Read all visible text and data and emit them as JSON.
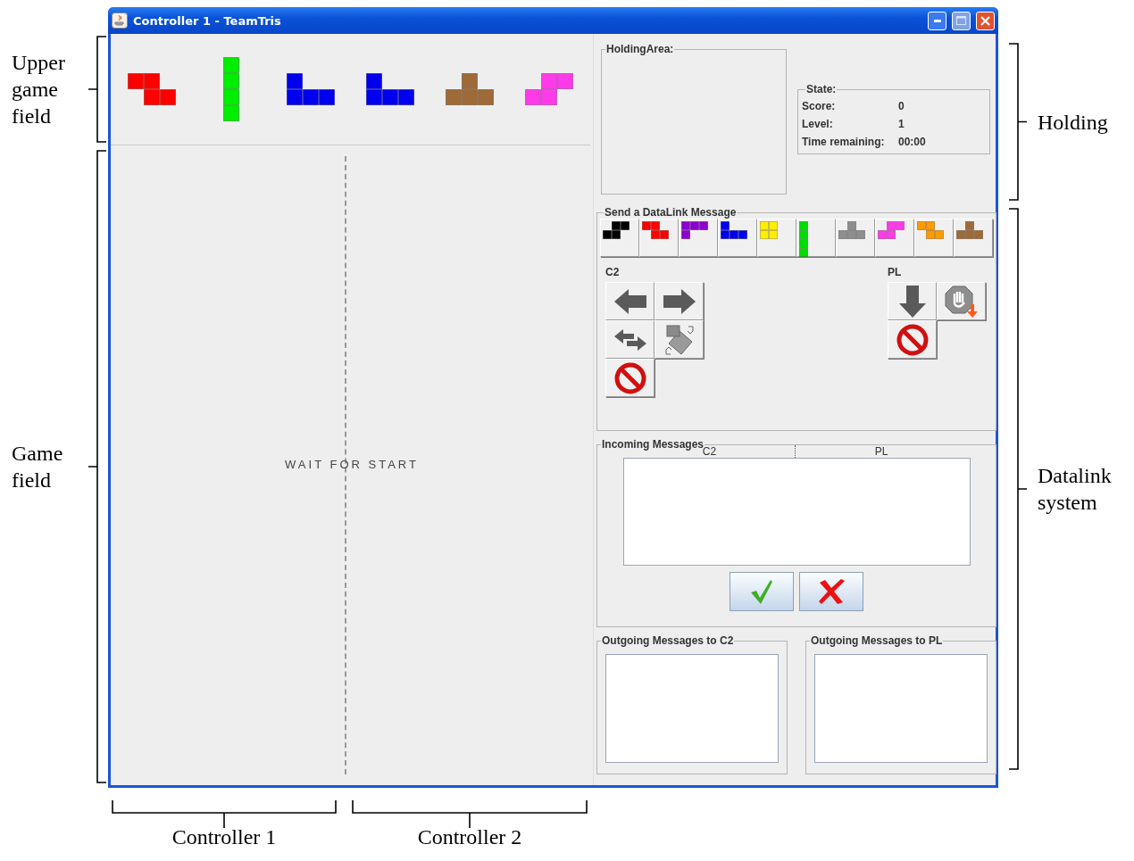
{
  "window": {
    "title": "Controller 1 - TeamTris"
  },
  "upper_field": {
    "pieces": [
      {
        "kind": "Z",
        "color": "#ff0000"
      },
      {
        "kind": "I",
        "color": "#00ee00"
      },
      {
        "kind": "J",
        "color": "#0000ee"
      },
      {
        "kind": "J",
        "color": "#0000ee"
      },
      {
        "kind": "T",
        "color": "#9e6a38"
      },
      {
        "kind": "S",
        "color": "#ff3ae8"
      }
    ]
  },
  "game_field": {
    "status": "WAIT FOR START"
  },
  "holding_area": {
    "title": "HoldingArea:"
  },
  "state": {
    "title": "State:",
    "rows": [
      {
        "label": "Score:",
        "value": "0"
      },
      {
        "label": "Level:",
        "value": "1"
      },
      {
        "label": "Time remaining:",
        "value": "00:00"
      }
    ]
  },
  "send_message": {
    "title": "Send a DataLink Message",
    "pieces": [
      {
        "kind": "S",
        "color": "#000000"
      },
      {
        "kind": "Z",
        "color": "#ff0000"
      },
      {
        "kind": "L",
        "color": "#8e00d0"
      },
      {
        "kind": "J",
        "color": "#0000ee"
      },
      {
        "kind": "O",
        "color": "#ffee00"
      },
      {
        "kind": "I",
        "color": "#00dd00"
      },
      {
        "kind": "T",
        "color": "#8e8e8e"
      },
      {
        "kind": "S",
        "color": "#ff3ae8"
      },
      {
        "kind": "Z",
        "color": "#ff9a00"
      },
      {
        "kind": "T",
        "color": "#9e6a38"
      }
    ],
    "groups": [
      {
        "label": "C2",
        "buttons": [
          {
            "kind": "left"
          },
          {
            "kind": "right"
          },
          {
            "kind": "swap"
          },
          {
            "kind": "rotate"
          },
          {
            "kind": "cancel"
          }
        ]
      },
      {
        "label": "PL",
        "buttons": [
          {
            "kind": "drop"
          },
          {
            "kind": "hold"
          },
          {
            "kind": "cancel"
          }
        ]
      }
    ]
  },
  "incoming": {
    "title": "Incoming Messages",
    "columns": [
      "C2",
      "PL"
    ],
    "buttons": [
      {
        "kind": "accept"
      },
      {
        "kind": "reject"
      }
    ]
  },
  "outgoing": [
    {
      "title": "Outgoing Messages to C2"
    },
    {
      "title": "Outgoing Messages to PL"
    }
  ],
  "annotations": {
    "left": [
      {
        "label": "Upper game field"
      },
      {
        "label": "Game field"
      }
    ],
    "right": [
      {
        "label": "Holding"
      },
      {
        "label": "Datalink system"
      }
    ],
    "bottom": [
      {
        "label": "Controller 1"
      },
      {
        "label": "Controller 2"
      }
    ]
  }
}
